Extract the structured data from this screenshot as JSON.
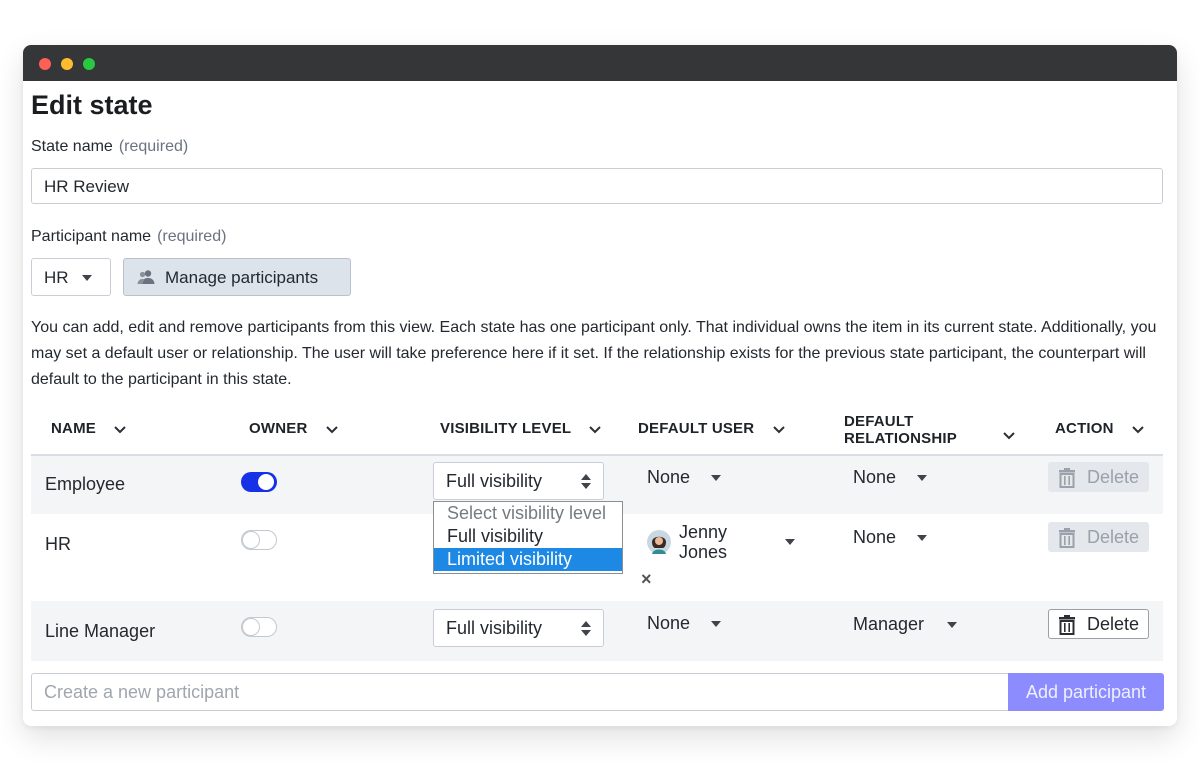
{
  "page": {
    "title": "Edit state",
    "state_name_label": "State name",
    "state_name_required": "(required)",
    "state_name_value": "HR Review",
    "participant_label": "Participant name",
    "participant_required": "(required)",
    "participant_selected": "HR",
    "manage_participants_label": "Manage participants",
    "help_text": "You can add, edit and remove participants from this view. Each state has one participant only. That individual owns the item in its current state. Additionally, you may set a default user or relationship. The user will take preference here if it set. If the relationship exists for the previous state participant, the counterpart will default to the participant in this state."
  },
  "table": {
    "headers": {
      "name": "NAME",
      "owner": "OWNER",
      "visibility": "VISIBILITY LEVEL",
      "default_user": "DEFAULT USER",
      "default_relationship_1": "DEFAULT",
      "default_relationship_2": "RELATIONSHIP",
      "action": "ACTION"
    },
    "rows": [
      {
        "name": "Employee",
        "owner": true,
        "visibility": "Full visibility",
        "default_user": "None",
        "default_relationship": "None",
        "action": "Delete",
        "action_enabled": false
      },
      {
        "name": "HR",
        "owner": false,
        "visibility": "",
        "default_user_line1": "Jenny",
        "default_user_line2": "Jones",
        "clear_symbol": "×",
        "default_relationship": "None",
        "action": "Delete",
        "action_enabled": false
      },
      {
        "name": "Line Manager",
        "owner": false,
        "visibility": "Full visibility",
        "default_user": "None",
        "default_relationship": "Manager",
        "action": "Delete",
        "action_enabled": true
      }
    ],
    "visibility_dropdown": {
      "placeholder": "Select visibility level",
      "options": [
        "Full visibility",
        "Limited visibility"
      ],
      "highlighted": "Limited visibility"
    }
  },
  "footer": {
    "create_placeholder": "Create a new participant",
    "add_label": "Add participant"
  },
  "colors": {
    "accent": "#1631e6",
    "add_button": "#8c8cff",
    "dropdown_highlight": "#1e88e5",
    "titlebar": "#353637"
  }
}
